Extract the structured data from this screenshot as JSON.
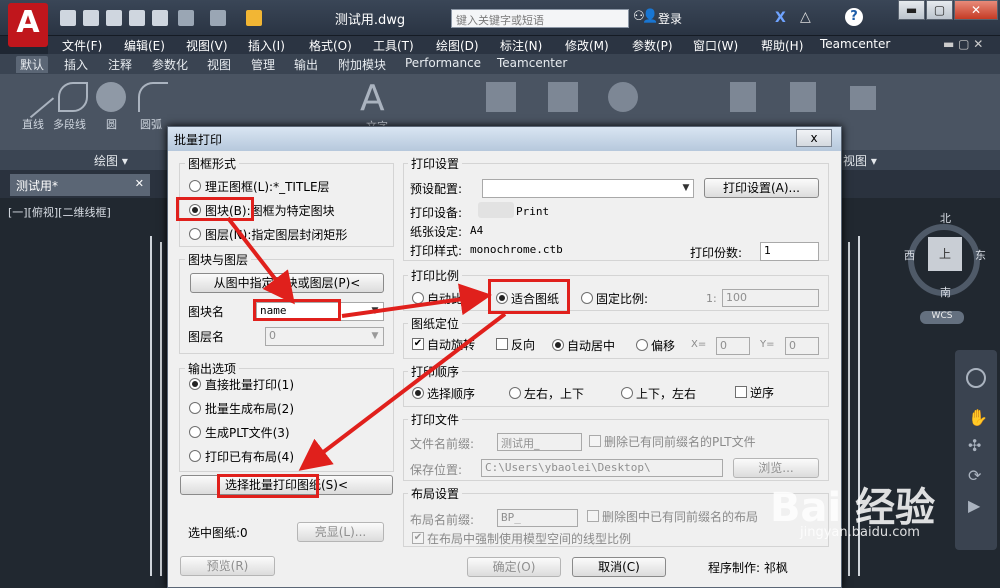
{
  "app": {
    "logo_letter": "A",
    "doc_title": "测试用.dwg",
    "search_placeholder": "键入关键字或短语",
    "login": "登录",
    "help": "?"
  },
  "menubar": [
    "文件(F)",
    "编辑(E)",
    "视图(V)",
    "插入(I)",
    "格式(O)",
    "工具(T)",
    "绘图(D)",
    "标注(N)",
    "修改(M)",
    "参数(P)",
    "窗口(W)",
    "帮助(H)",
    "Teamcenter"
  ],
  "ribbon_tabs": [
    "默认",
    "插入",
    "注释",
    "参数化",
    "视图",
    "管理",
    "输出",
    "附加模块",
    "Performance",
    "Teamcenter"
  ],
  "ribbon": {
    "panel_draw": "绘图 ▾",
    "panel_view": "视图 ▾",
    "tool_line": "直线",
    "tool_polyline": "多段线",
    "tool_circle": "圆",
    "tool_arc": "圆弧",
    "tool_text": "文字"
  },
  "doc_tab": "测试用*",
  "view_label": "[一][俯视][二维线框]",
  "compass": {
    "n": "北",
    "s": "南",
    "e": "东",
    "w": "西",
    "center": "上",
    "wcs": "WCS"
  },
  "dialog": {
    "title": "批量打印",
    "close": "x",
    "frame_group": "图框形式",
    "frame_options": [
      {
        "label": "理正图框(L):*_TITLE层",
        "checked": false
      },
      {
        "label": "图块(B):图框为特定图块",
        "checked": true
      },
      {
        "label": "图层(N):指定图层封闭矩形",
        "checked": false
      }
    ],
    "block_group": "图块与图层",
    "pick_button": "从图中指定图块或图层(P)<",
    "block_name_label": "图块名",
    "block_name_value": "name",
    "layer_name_label": "图层名",
    "layer_name_value": "0",
    "output_group": "输出选项",
    "output_options": [
      {
        "label": "直接批量打印(1)",
        "checked": true
      },
      {
        "label": "批量生成布局(2)",
        "checked": false
      },
      {
        "label": "生成PLT文件(3)",
        "checked": false
      },
      {
        "label": "打印已有布局(4)",
        "checked": false
      }
    ],
    "select_button": "选择批量打印图纸(S)<",
    "selected_label": "选中图纸:0",
    "highlight_button": "亮显(L)...",
    "preview_button": "预览(R)",
    "ok_button": "确定(O)",
    "cancel_button": "取消(C)",
    "author": "程序制作: 祁枫",
    "print_settings_group": "打印设置",
    "preset_label": "预设配置:",
    "print_setup_button": "打印设置(A)...",
    "device_label": "打印设备:",
    "device_value": "Print",
    "paper_label": "纸张设定:",
    "paper_value": "A4",
    "style_label": "打印样式:",
    "style_value": "monochrome.ctb",
    "copies_label": "打印份数:",
    "copies_value": "1",
    "scale_group": "打印比例",
    "scale_options": [
      {
        "label": "自动比例",
        "checked": false
      },
      {
        "label": "适合图纸",
        "checked": true
      },
      {
        "label": "固定比例:",
        "checked": false
      }
    ],
    "scale_prefix": "1:",
    "scale_value": "100",
    "position_group": "图纸定位",
    "auto_rotate": "自动旋转",
    "reverse": "反向",
    "auto_center": "自动居中",
    "offset": "偏移",
    "x_label": "X=",
    "x_value": "0",
    "y_label": "Y=",
    "y_value": "0",
    "order_group": "打印顺序",
    "order_options": [
      {
        "label": "选择顺序",
        "checked": true
      },
      {
        "label": "左右，上下",
        "checked": false
      },
      {
        "label": "上下，左右",
        "checked": false
      }
    ],
    "reverse_order": "逆序",
    "file_group": "打印文件",
    "file_prefix_label": "文件名前缀:",
    "file_prefix_value": "测试用_",
    "delete_plt": "删除已有同前缀名的PLT文件",
    "save_path_label": "保存位置:",
    "save_path_value": "C:\\Users\\ybaolei\\Desktop\\",
    "browse_button": "浏览...",
    "layout_group": "布局设置",
    "layout_prefix_label": "布局名前缀:",
    "layout_prefix_value": "BP_",
    "delete_layout": "删除图中已有同前缀名的布局",
    "force_linetype": "在布局中强制使用模型空间的线型比例"
  },
  "watermark": {
    "brand": "Bai 经验",
    "url": "jingyan.baidu.com"
  },
  "colors": {
    "accent_red": "#e0201c",
    "autocad_red": "#c0161c"
  }
}
